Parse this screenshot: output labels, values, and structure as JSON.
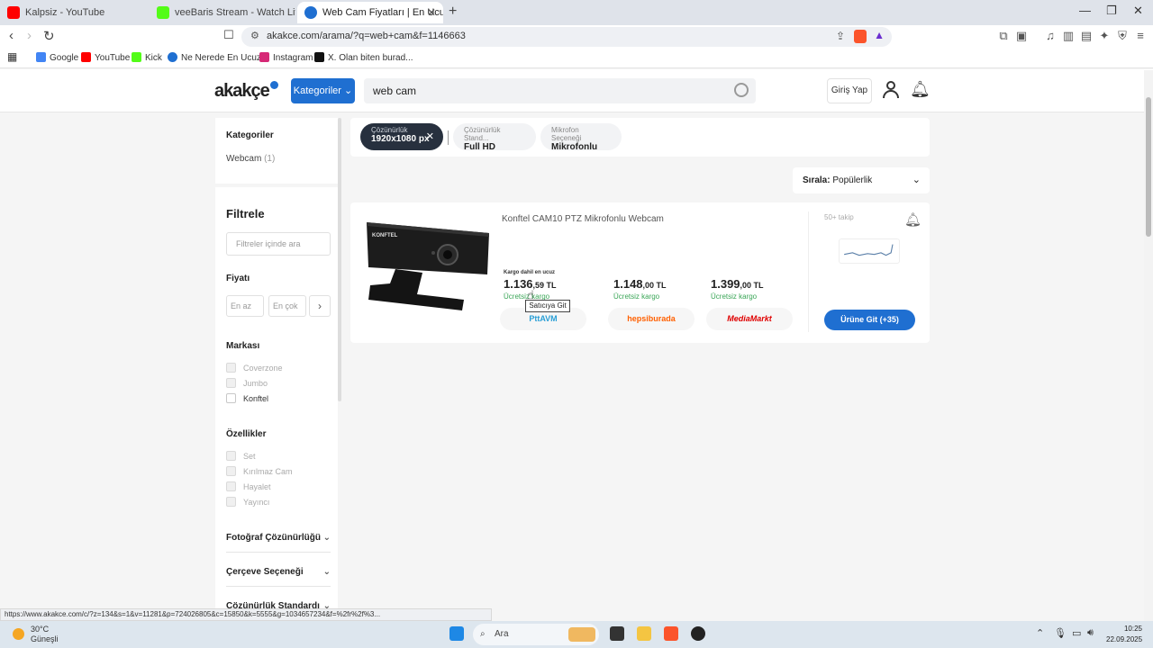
{
  "browser": {
    "tabs": [
      {
        "title": "Kalpsiz - YouTube",
        "color": "#ff0000"
      },
      {
        "title": "veeBaris Stream - Watch Live on Kick",
        "color": "#53fc18"
      },
      {
        "title": "Web Cam Fiyatları | En Ucuzu Ak",
        "color": "#1f6fd1"
      }
    ],
    "url": "akakce.com/arama/?q=web+cam&f=1146663",
    "bookmarks": [
      {
        "label": "Google",
        "color": "#4285f4"
      },
      {
        "label": "YouTube",
        "color": "#ff0000"
      },
      {
        "label": "Kick",
        "color": "#53fc18"
      },
      {
        "label": "Ne Nerede En Ucuz...",
        "color": "#1f6fd1"
      },
      {
        "label": "Instagram",
        "color": "#d62976"
      },
      {
        "label": "X. Olan biten burad...",
        "color": "#111111"
      }
    ]
  },
  "header": {
    "logo": "akakçe",
    "categories_button": "Kategoriler",
    "search_value": "web cam",
    "login_button": "Giriş Yap"
  },
  "sidebar": {
    "categories_title": "Kategoriler",
    "category_item": "Webcam",
    "category_count": "(1)",
    "filter_title": "Filtrele",
    "filter_search_placeholder": "Filtreler içinde ara",
    "price_title": "Fiyatı",
    "price_min": "En az",
    "price_max": "En çok",
    "brand_title": "Markası",
    "brands": [
      "Coverzone",
      "Jumbo",
      "Konftel"
    ],
    "features_title": "Özellikler",
    "features": [
      "Set",
      "Kırılmaz Cam",
      "Hayalet",
      "Yayıncı"
    ],
    "collapsed": [
      "Fotoğraf Çözünürlüğü",
      "Çerçeve Seçeneği",
      "Çözünürlük Standardı"
    ]
  },
  "chips": [
    {
      "label": "Çözünürlük",
      "value": "1920x1080 px"
    },
    {
      "label": "Çözünürlük Stand...",
      "value": "Full HD"
    },
    {
      "label": "Mikrofon Seçeneği",
      "value": "Mikrofonlu"
    }
  ],
  "sort": {
    "label": "Sırala:",
    "value": "Popülerlik"
  },
  "product": {
    "title": "Konftel CAM10 PTZ Mikrofonlu Webcam",
    "image_brand": "KONFTEL",
    "cheapest_label": "Kargo dahil en ucuz",
    "offers": [
      {
        "price_main": "1.136",
        "price_cents": ",59 TL",
        "shipping": "Ücretsiz kargo",
        "merchant": "PttAVM",
        "merchant_color": "#2a9fd6"
      },
      {
        "price_main": "1.148",
        "price_cents": ",00 TL",
        "shipping": "Ücretsiz kargo",
        "merchant": "hepsiburada",
        "merchant_color": "#ff6000"
      },
      {
        "price_main": "1.399",
        "price_cents": ",00 TL",
        "shipping": "Ücretsiz kargo",
        "merchant": "MediaMarkt",
        "merchant_color": "#df0000"
      }
    ],
    "followers": "50+ takip",
    "go_button": "Ürüne Git (+35)",
    "tooltip": "Satıcıya Git"
  },
  "status_url": "https://www.akakce.com/c/?z=134&s=1&v=11281&p=724026805&c=15850&k=5555&g=1034657234&f=%2fr%2f%3...",
  "taskbar": {
    "temp": "30°C",
    "weather": "Güneşli",
    "search": "Ara",
    "time": "10:25",
    "date": "22.09.2025"
  }
}
